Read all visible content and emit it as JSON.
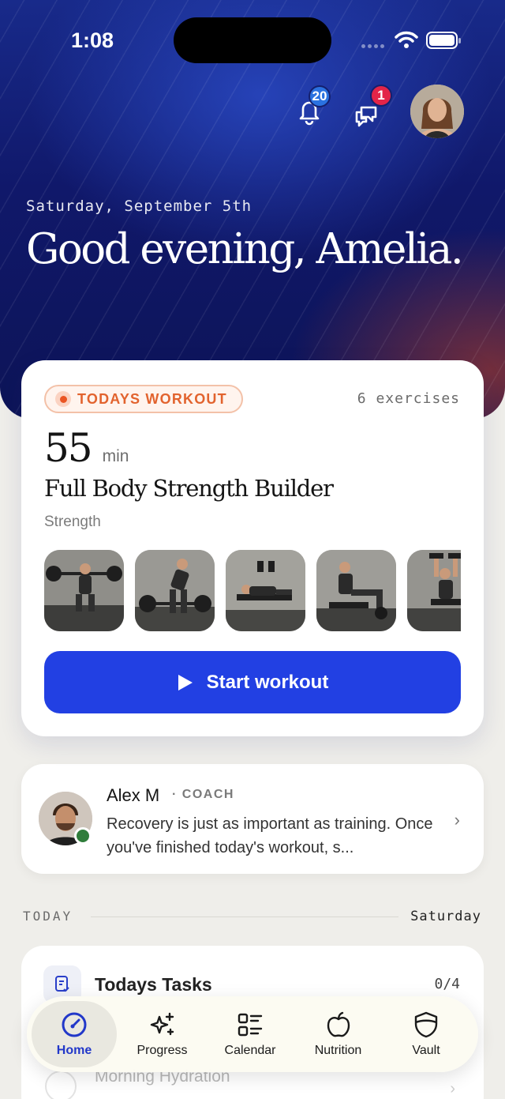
{
  "status": {
    "time": "1:08"
  },
  "header": {
    "notifications_count": "20",
    "messages_count": "1",
    "date": "Saturday, September 5th",
    "greeting": "Good evening, Amelia."
  },
  "workout": {
    "tag": "TODAYS WORKOUT",
    "exercise_count": "6 exercises",
    "duration": "55",
    "duration_unit": "min",
    "title": "Full Body Strength Builder",
    "category": "Strength",
    "start_label": "Start workout"
  },
  "coach": {
    "name": "Alex M",
    "role": "· COACH",
    "message": "Recovery is just as important as training. Once you've finished today's workout, s..."
  },
  "today": {
    "label": "TODAY",
    "day": "Saturday"
  },
  "tasks": {
    "title": "Todays Tasks",
    "count": "0/4",
    "first_item": "Morning Hydration"
  },
  "tabbar": {
    "home": "Home",
    "progress": "Progress",
    "calendar": "Calendar",
    "nutrition": "Nutrition",
    "vault": "Vault",
    "active": "Home"
  },
  "colors": {
    "accent_blue": "#2240e3",
    "tag_orange": "#e2632e",
    "hero_navy": "#10186a",
    "badge_red": "#e32448",
    "badge_blue": "#2a72e0",
    "online_green": "#2f7d3b"
  }
}
